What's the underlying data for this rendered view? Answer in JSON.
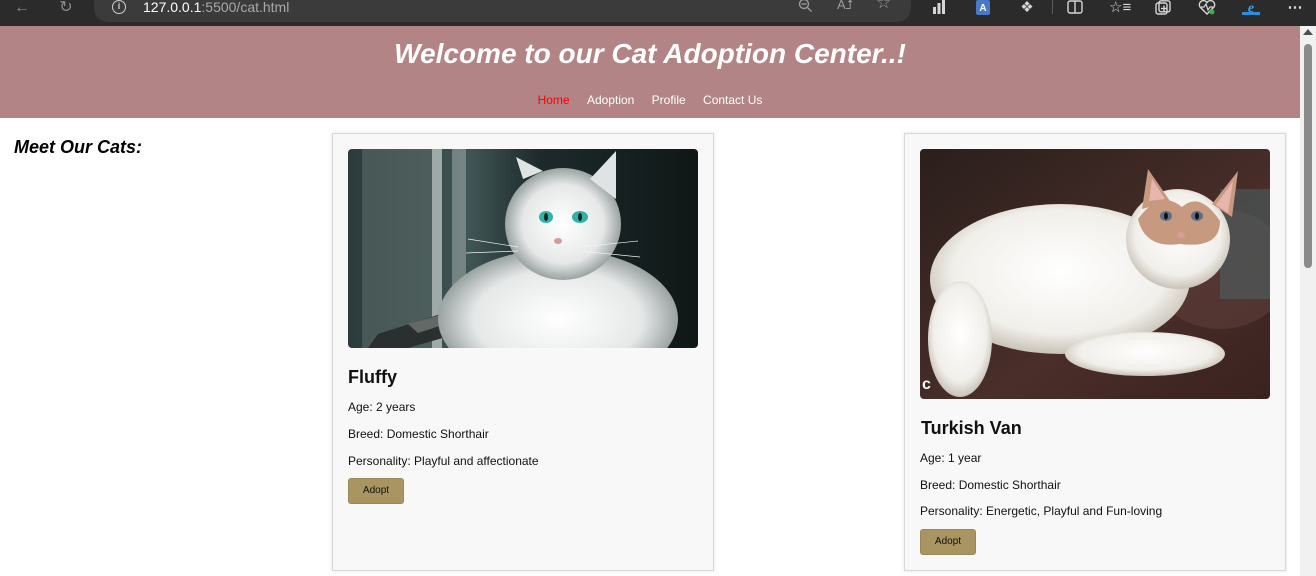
{
  "browser": {
    "url_host": "127.0.0.1",
    "url_path": ":5500/cat.html",
    "icons": [
      "back-icon",
      "refresh-icon",
      "info-icon",
      "zoom-out-icon",
      "read-aloud-icon",
      "favorite-star-icon",
      "extension-bars-icon",
      "extension-a-icon",
      "extensions-puzzle-icon",
      "split-screen-icon",
      "favorites-list-icon",
      "collections-icon",
      "browser-health-icon",
      "edge-logo-icon",
      "more-menu-icon"
    ]
  },
  "header": {
    "title": "Welcome to our Cat Adoption Center..!",
    "nav": [
      {
        "label": "Home",
        "active": true
      },
      {
        "label": "Adoption",
        "active": false
      },
      {
        "label": "Profile",
        "active": false
      },
      {
        "label": "Contact Us",
        "active": false
      }
    ],
    "background_color": "#b38485",
    "active_color": "#ff0000"
  },
  "section": {
    "title": "Meet Our Cats:"
  },
  "cats": [
    {
      "name": "Fluffy",
      "age": "Age: 2 years",
      "breed": "Breed: Domestic Shorthair",
      "personality": "Personality: Playful and affectionate",
      "button": "Adopt"
    },
    {
      "name": "Turkish Van",
      "age": "Age: 1 year",
      "breed": "Breed: Domestic Shorthair",
      "personality": "Personality: Energetic, Playful and Fun-loving",
      "button": "Adopt"
    }
  ],
  "colors": {
    "adopt_button": "#a89561",
    "card_background": "#f8f8f8"
  }
}
